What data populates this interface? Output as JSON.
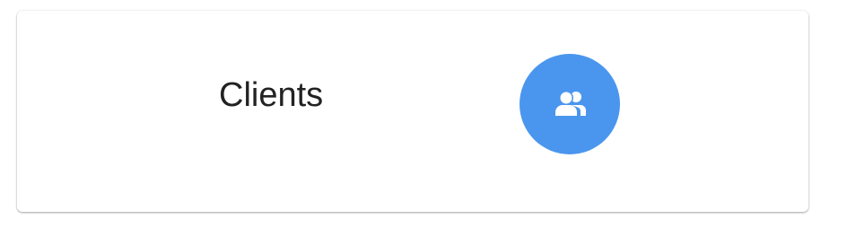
{
  "card": {
    "title": "Clients",
    "icon": "users-icon"
  },
  "colors": {
    "icon_background": "#4a96ee",
    "icon_foreground": "#ffffff",
    "title_text": "#222222",
    "card_background": "#ffffff"
  }
}
